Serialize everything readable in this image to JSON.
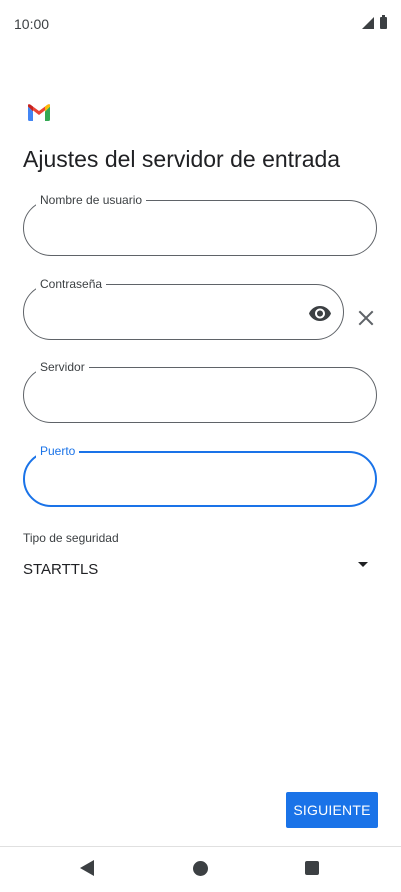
{
  "status_bar": {
    "time": "10:00"
  },
  "app": {
    "logo_icon": "gmail-logo-icon",
    "title": "Ajustes del servidor de entrada"
  },
  "form": {
    "username": {
      "label": "Nombre de usuario",
      "value": ""
    },
    "password": {
      "label": "Contraseña",
      "value": "",
      "toggle_icon": "eye-icon",
      "clear_icon": "close-icon"
    },
    "server": {
      "label": "Servidor",
      "value": ""
    },
    "port": {
      "label": "Puerto",
      "value": "",
      "focused": true
    },
    "security": {
      "label": "Tipo de seguridad",
      "value": "STARTTLS"
    }
  },
  "actions": {
    "next_label": "SIGUIENTE"
  },
  "colors": {
    "accent": "#1a73e8",
    "text": "#202124",
    "outline": "#5f6368"
  }
}
